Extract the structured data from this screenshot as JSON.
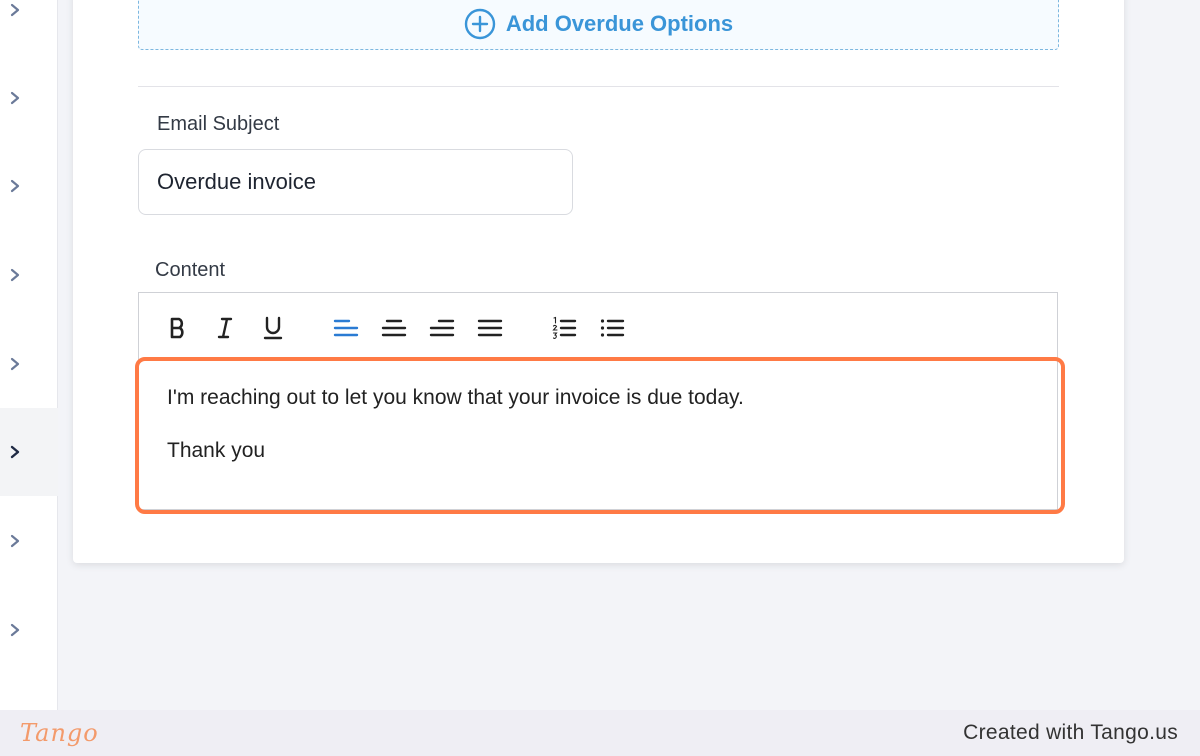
{
  "sidebar": {
    "items": [
      {
        "icon": "chevron-right-icon",
        "active": false
      },
      {
        "icon": "chevron-right-icon",
        "active": false
      },
      {
        "icon": "chevron-right-icon",
        "active": false
      },
      {
        "icon": "chevron-right-icon",
        "active": false
      },
      {
        "icon": "chevron-right-icon",
        "active": false
      },
      {
        "icon": "chevron-right-icon",
        "active": true
      },
      {
        "icon": "chevron-right-icon",
        "active": false
      },
      {
        "icon": "chevron-right-icon",
        "active": false
      }
    ]
  },
  "overdue": {
    "add_label": "Add Overdue Options",
    "icon": "plus-circle-icon"
  },
  "email_subject": {
    "label": "Email Subject",
    "value": "Overdue invoice"
  },
  "content": {
    "label": "Content",
    "toolbar": [
      "bold-icon",
      "italic-icon",
      "underline-icon",
      "align-left-icon",
      "align-center-icon",
      "align-right-icon",
      "align-justify-icon",
      "ordered-list-icon",
      "bullet-list-icon"
    ],
    "active_tool": "align-left-icon",
    "paragraphs": [
      "I'm reaching out to let you know that your invoice is due today.",
      "Thank you"
    ]
  },
  "colors": {
    "accent_blue": "#3a95d8",
    "active_tool_blue": "#2a7bd3",
    "highlight_orange": "#ff7a45",
    "chevron": "#6b7a99",
    "chevron_active": "#1f2a44"
  },
  "footer": {
    "logo": "Tango",
    "text": "Created with Tango.us"
  }
}
